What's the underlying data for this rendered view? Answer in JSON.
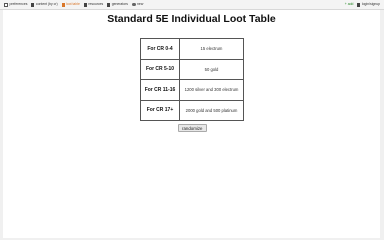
{
  "nav": {
    "items": [
      {
        "label": "preferences",
        "icon": "preferences-icon"
      },
      {
        "label": "content (by cr)",
        "icon": "content-icon"
      },
      {
        "label": "loot table",
        "icon": "loot-icon",
        "active": true
      },
      {
        "label": "resources",
        "icon": "resources-icon"
      },
      {
        "label": "generators",
        "icon": "generators-icon"
      },
      {
        "label": "new",
        "icon": "new-icon"
      }
    ],
    "add_label": "+ add",
    "auth_label": "login/signup"
  },
  "page": {
    "title": "Standard 5E Individual Loot Table"
  },
  "loot_table": {
    "rows": [
      {
        "cr": "For CR 0-4",
        "loot": "15 electrum"
      },
      {
        "cr": "For CR 5-10",
        "loot": "50 gold"
      },
      {
        "cr": "For CR 11-16",
        "loot": "1200 silver and 300 electrum"
      },
      {
        "cr": "For CR 17+",
        "loot": "2000 gold and 500 platinum"
      }
    ]
  },
  "randomize_button": {
    "label": "randomize"
  },
  "colors": {
    "active_nav": "#d9772a",
    "add_link": "#2a8a2a",
    "page_bg": "#ffffff",
    "window_bg": "#f0f0f0"
  }
}
